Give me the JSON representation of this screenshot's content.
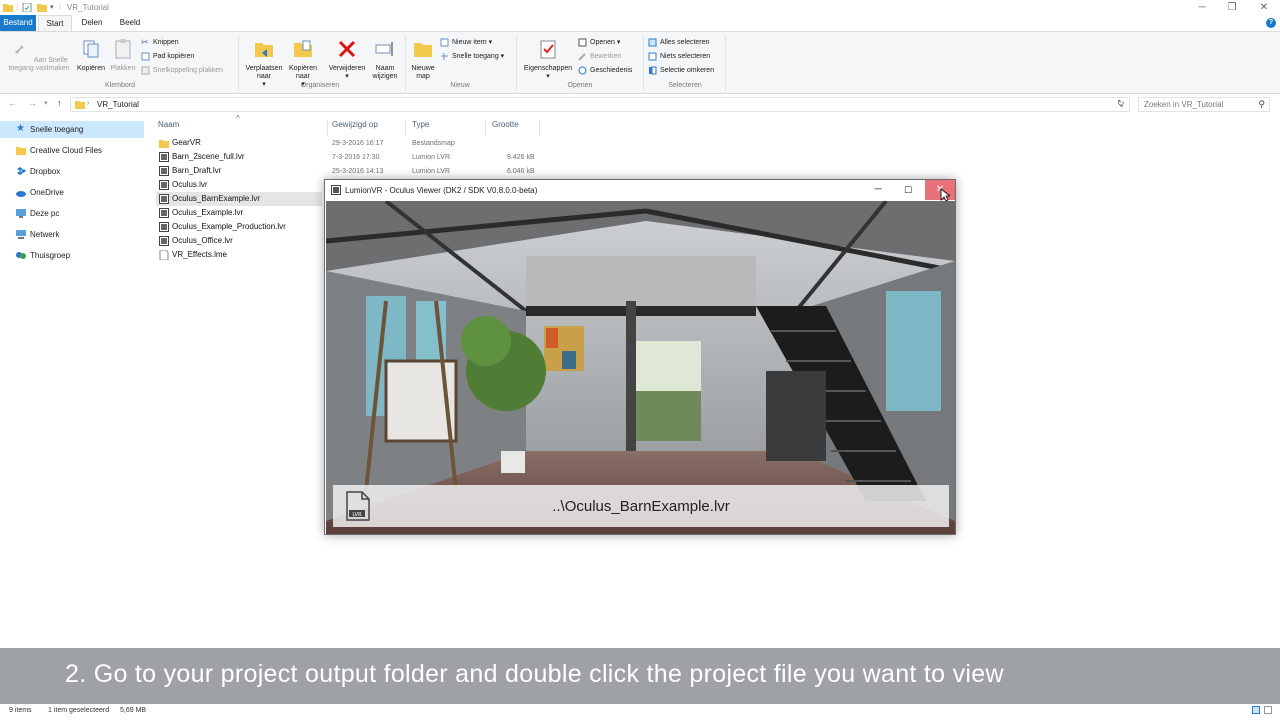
{
  "window": {
    "title": "VR_Tutorial"
  },
  "ribbon_tabs": [
    "Bestand",
    "Start",
    "Delen",
    "Beeld"
  ],
  "ribbon": {
    "klembord": {
      "label": "Klembord",
      "pin": "Aan Snelle toegang vastmaken",
      "copy": "Kopiëren",
      "paste": "Plakken",
      "cut": "Knippen",
      "copy_path": "Pad kopiëren",
      "paste_shortcut": "Snelkoppeling plakken"
    },
    "organiseren": {
      "label": "Organiseren",
      "move": "Verplaatsen naar",
      "copy_to": "Kopiëren naar",
      "delete": "Verwijderen",
      "rename": "Naam wijzigen"
    },
    "nieuw": {
      "label": "Nieuw",
      "new_folder": "Nieuwe map",
      "new_item": "Nieuw item",
      "easy_access": "Snelle toegang"
    },
    "openen": {
      "label": "Openen",
      "properties": "Eigenschappen",
      "open": "Openen",
      "edit": "Bewerken",
      "history": "Geschiedenis"
    },
    "selecteren": {
      "label": "Selecteren",
      "select_all": "Alles selecteren",
      "select_none": "Niets selecteren",
      "invert": "Selectie omkeren"
    }
  },
  "address": {
    "path": "VR_Tutorial",
    "search_placeholder": "Zoeken in VR_Tutorial"
  },
  "nav": [
    {
      "label": "Snelle toegang",
      "selected": true,
      "icon": "star-icon"
    },
    {
      "label": "Creative Cloud Files",
      "selected": false,
      "icon": "cloud-icon"
    },
    {
      "label": "Dropbox",
      "selected": false,
      "icon": "dropbox-icon"
    },
    {
      "label": "OneDrive",
      "selected": false,
      "icon": "onedrive-icon"
    },
    {
      "label": "Deze pc",
      "selected": false,
      "icon": "computer-icon"
    },
    {
      "label": "Netwerk",
      "selected": false,
      "icon": "network-icon"
    },
    {
      "label": "Thuisgroep",
      "selected": false,
      "icon": "homegroup-icon"
    }
  ],
  "columns": [
    "Naam",
    "Gewijzigd op",
    "Type",
    "Grootte"
  ],
  "files": [
    {
      "name": "GearVR",
      "date": "29-3-2016 16:17",
      "type": "Bestandsmap",
      "size": "",
      "kind": "folder"
    },
    {
      "name": "Barn_2scene_full.lvr",
      "date": "7-3-2016 17:30",
      "type": "Lumion LVR",
      "size": "9.426 kB",
      "kind": "lvr"
    },
    {
      "name": "Barn_Draft.lvr",
      "date": "25-3-2016 14:13",
      "type": "Lumion LVR",
      "size": "6.046 kB",
      "kind": "lvr"
    },
    {
      "name": "Oculus.lvr",
      "date": "",
      "type": "",
      "size": "",
      "kind": "lvr"
    },
    {
      "name": "Oculus_BarnExample.lvr",
      "date": "",
      "type": "",
      "size": "",
      "kind": "lvr",
      "selected": true
    },
    {
      "name": "Oculus_Example.lvr",
      "date": "",
      "type": "",
      "size": "",
      "kind": "lvr"
    },
    {
      "name": "Oculus_Example_Production.lvr",
      "date": "",
      "type": "",
      "size": "",
      "kind": "lvr"
    },
    {
      "name": "Oculus_Office.lvr",
      "date": "",
      "type": "",
      "size": "",
      "kind": "lvr"
    },
    {
      "name": "VR_Effects.lme",
      "date": "",
      "type": "",
      "size": "",
      "kind": "lme"
    }
  ],
  "viewer": {
    "title": "LumionVR - Oculus Viewer (DK2 / SDK V0.8.0.0-beta)",
    "loading_file": "..\\Oculus_BarnExample.lvr",
    "loading_icon_label": "LVR"
  },
  "caption": "2. Go to your project output folder and double click the project file you want to view",
  "status": {
    "items": "9 items",
    "selected": "1 item geselecteerd",
    "size": "5,69 MB"
  },
  "colors": {
    "accent": "#1979ca",
    "selection": "#cce8ff",
    "close_hover": "#e8727a"
  }
}
